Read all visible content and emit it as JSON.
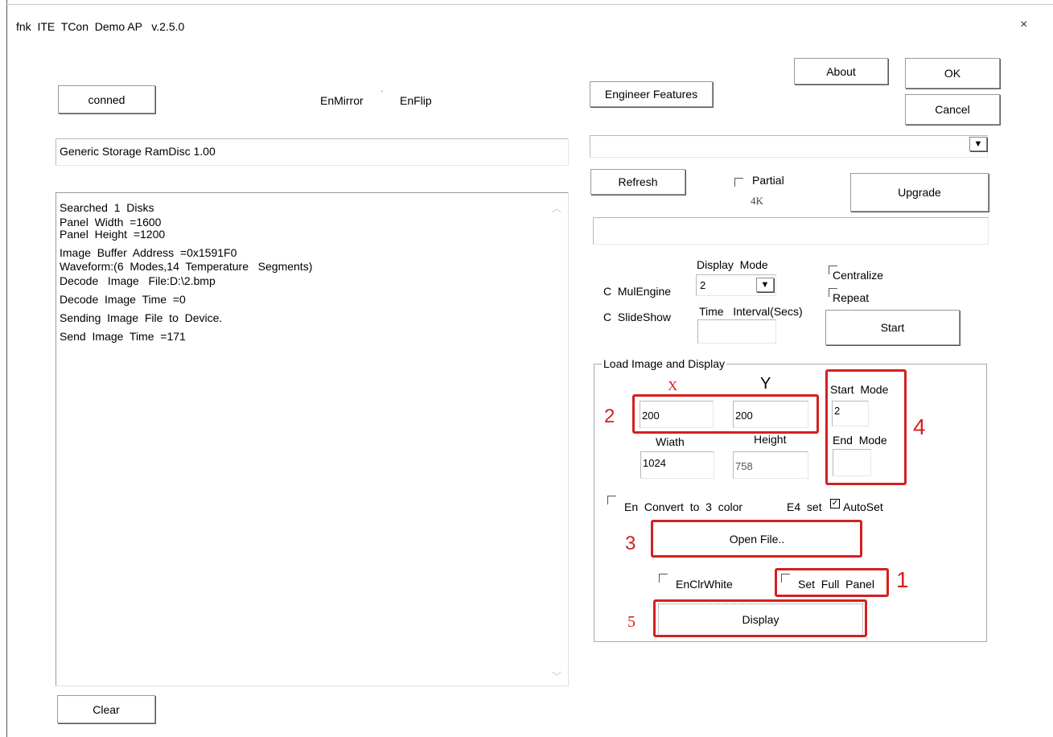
{
  "window": {
    "title": "fnk  ITE  TCon  Demo AP   v.2.5.0",
    "close_glyph": "×"
  },
  "top": {
    "conned_label": "conned",
    "enmirror_label": "EnMirror",
    "enflip_label": "EnFlip",
    "engineer_features_label": "Engineer  Features",
    "about_label": "About",
    "ok_label": "OK",
    "cancel_label": "Cancel"
  },
  "device": {
    "name_value": "Generic  Storage  RamDisc  1.00",
    "dropdown_value": ""
  },
  "controls": {
    "refresh_label": "Refresh",
    "partial_label": "Partial",
    "four_k_label": "4K",
    "upgrade_label": "Upgrade",
    "display_mode_label": "Display  Mode",
    "display_mode_value": "2",
    "mulengine_label": "C  MulEngine",
    "slideshow_label": "C  SlideShow",
    "time_interval_label": "Time   Interval(Secs)",
    "centralize_label": "Centralize",
    "repeat_label": "Repeat",
    "start_label": "Start"
  },
  "log": {
    "lines": [
      "Searched  1  Disks",
      "Panel  Width  =1600",
      "Panel  Height  =1200",
      "Image  Buffer  Address  =0x1591F0",
      "Waveform:(6  Modes,14  Temperature   Segments)",
      "Decode   Image   File:D:\\2.bmp",
      "Decode  Image  Time  =0",
      "Sending  Image  File  to  Device.",
      "Send  Image  Time  =171"
    ]
  },
  "clear_label": "Clear",
  "load_image": {
    "group_title": "Load  Image  and  Display",
    "x_label": "X",
    "y_label": "Y",
    "x_value": "200",
    "y_value": "200",
    "width_label": "Wiath",
    "height_label": "Height",
    "width_value": "1024",
    "height_value": "758",
    "start_mode_label": "Start  Mode",
    "start_mode_value": "2",
    "end_mode_label": "End  Mode",
    "convert_label": "En  Convert  to  3  color",
    "e4set_label": "E4  set",
    "autoset_label": "AutoSet",
    "open_file_label": "Open   File..",
    "enclrwhite_label": "EnClrWhite",
    "set_full_panel_label": "Set  Full  Panel",
    "display_label": "Display"
  },
  "annotations": {
    "n1": "1",
    "n2": "2",
    "n3": "3",
    "n4": "4",
    "n5": "5",
    "annotation_color": "#d42020"
  }
}
